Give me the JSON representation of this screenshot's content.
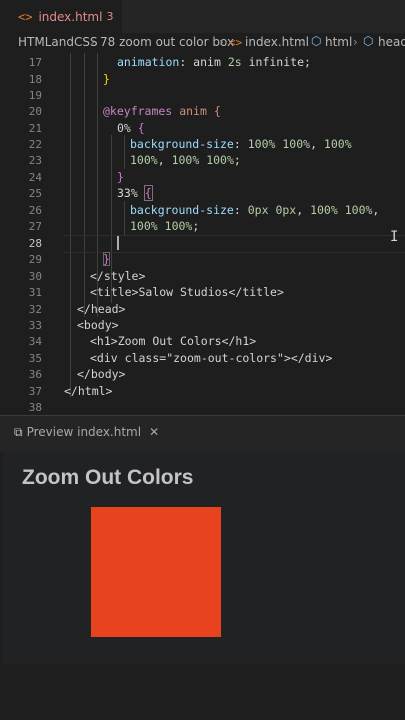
{
  "tab": {
    "brackets": "<>",
    "filename": "index.html",
    "problems": "3"
  },
  "breadcrumb": {
    "root": "HTMLandCSS",
    "sep": "›",
    "folder": "78 zoom out color box",
    "file_icon": "<>",
    "file": "index.html",
    "html": "html",
    "head": "head"
  },
  "code": {
    "l17": {
      "n": "17",
      "prop": "animation",
      "val1": "anim",
      "val2": "2s",
      "val3": "infinite"
    },
    "l18": {
      "n": "18",
      "text": "}"
    },
    "l19": {
      "n": "19"
    },
    "l20": {
      "n": "20",
      "kw": "@keyframes",
      "name": "anim",
      "brace": "{"
    },
    "l21": {
      "n": "21",
      "sel": "0%",
      "brace": "{"
    },
    "l22": {
      "n": "22",
      "prop": "background-size",
      "v1": "100%",
      "v2": "100%",
      "v3": "100%"
    },
    "l23": {
      "n": "23",
      "v1": "100%",
      "v2": "100%",
      "v3": "100%"
    },
    "l24": {
      "n": "24",
      "text": "}"
    },
    "l25": {
      "n": "25",
      "sel": "33%",
      "brace": "{"
    },
    "l26": {
      "n": "26",
      "prop": "background-size",
      "v1": "0px",
      "v2": "0px",
      "v3": "100%",
      "v4": "100%"
    },
    "l27": {
      "n": "27",
      "v1": "100%",
      "v2": "100%"
    },
    "l28": {
      "n": "28"
    },
    "l29": {
      "n": "29",
      "text": "}"
    },
    "l30": {
      "n": "30",
      "text": "</style>"
    },
    "l31": {
      "n": "31",
      "open": "<title>",
      "content": "Salow Studios",
      "close": "</title>"
    },
    "l32": {
      "n": "32",
      "text": "</head>"
    },
    "l33": {
      "n": "33",
      "text": "<body>"
    },
    "l34": {
      "n": "34",
      "open": "<h1>",
      "content": "Zoom Out Colors",
      "close": "</h1>"
    },
    "l35": {
      "n": "35",
      "tag": "<div",
      "attr": "class",
      "val": "\"zoom-out-colors\"",
      "close": "></div>"
    },
    "l36": {
      "n": "36",
      "text": "</body>"
    },
    "l37": {
      "n": "37",
      "text": "</html>"
    },
    "l38": {
      "n": "38"
    }
  },
  "preview": {
    "tab_label": "Preview index.html",
    "close": "✕",
    "heading": "Zoom Out Colors",
    "box_color": "#e8421e"
  }
}
